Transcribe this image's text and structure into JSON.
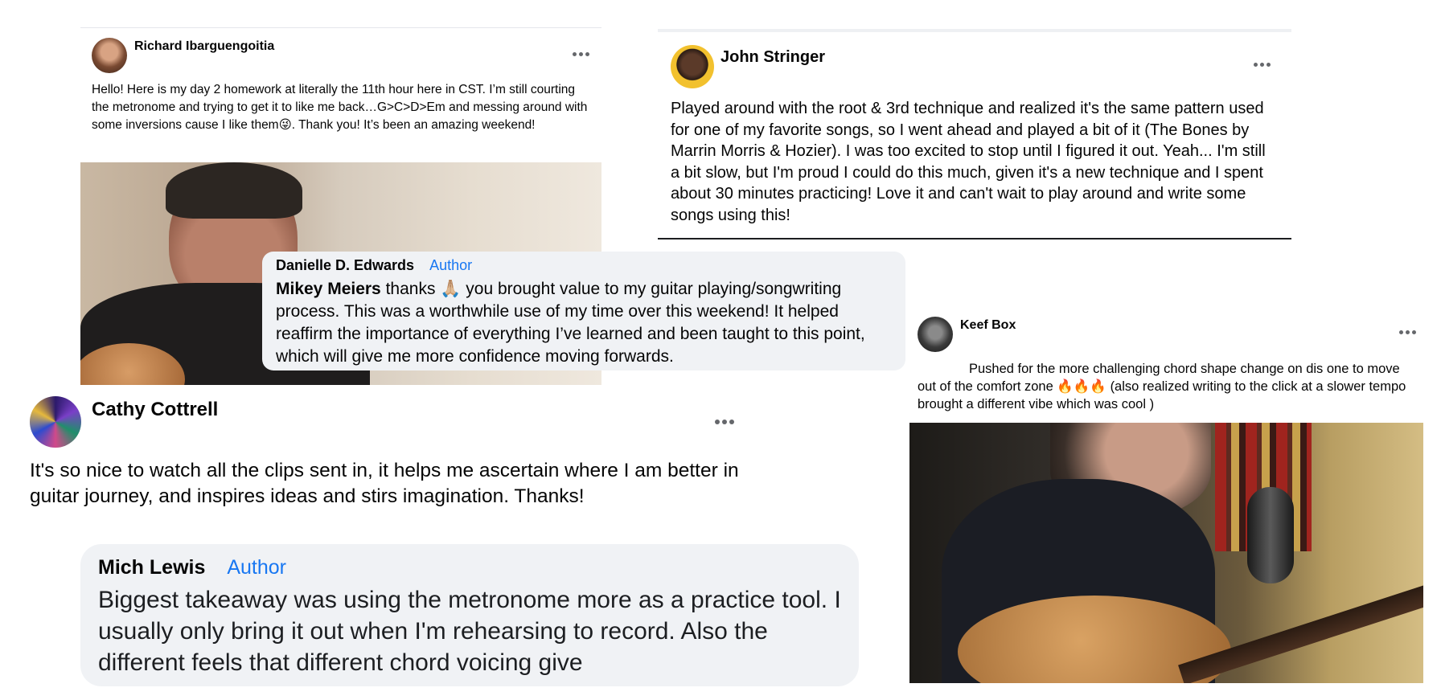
{
  "posts": {
    "richard": {
      "name": "Richard Ibarguengoitia",
      "text": "Hello! Here is my day 2 homework at literally the 11th hour here in CST. I’m still courting the metronome and trying to get it to like me back…G>C>D>Em and messing around with some inversions cause I like them😜. Thank you! It’s been an amazing weekend!",
      "more_icon": "more-horizontal-icon"
    },
    "john": {
      "name": "John Stringer",
      "text": "Played around with the root & 3rd technique and realized it's the same pattern used for one of my favorite songs, so I went ahead and played a bit of it (The Bones by Marrin Morris & Hozier). I was too excited to stop until I figured it out. Yeah... I'm still a bit slow, but I'm proud I could do this much, given it's a new technique and I spent about 30 minutes practicing! Love it and can't wait to play around and write some songs using this!",
      "more_icon": "more-horizontal-icon"
    },
    "keef": {
      "name": "Keef Box",
      "text": "Pushed for the more challenging chord shape change on dis one to move out of the comfort zone 🔥🔥🔥 (also realized writing to the click at a slower tempo brought a different vibe which was cool )",
      "more_icon": "more-horizontal-icon"
    },
    "cathy": {
      "name": "Cathy Cottrell",
      "text": "It's so nice to watch all the clips sent in, it helps me ascertain where I am better in guitar journey, and inspires ideas and stirs imagination. Thanks!",
      "more_icon": "more-horizontal-icon"
    }
  },
  "comments": {
    "danielle": {
      "name": "Danielle D. Edwards",
      "badge": "Author",
      "mention": "Mikey Meiers",
      "text": " thanks 🙏🏼 you brought value to my guitar playing/songwriting process. This was a worthwhile use of my time over this weekend! It helped reaffirm the importance of everything I’ve learned and been taught to this point, which will give me more confidence moving forwards."
    },
    "mich": {
      "name": "Mich Lewis",
      "badge": "Author",
      "text": "Biggest takeaway was using the metronome more as a practice tool. I usually only bring it out when I'm rehearsing to record. Also the different feels that different chord voicing give"
    }
  }
}
